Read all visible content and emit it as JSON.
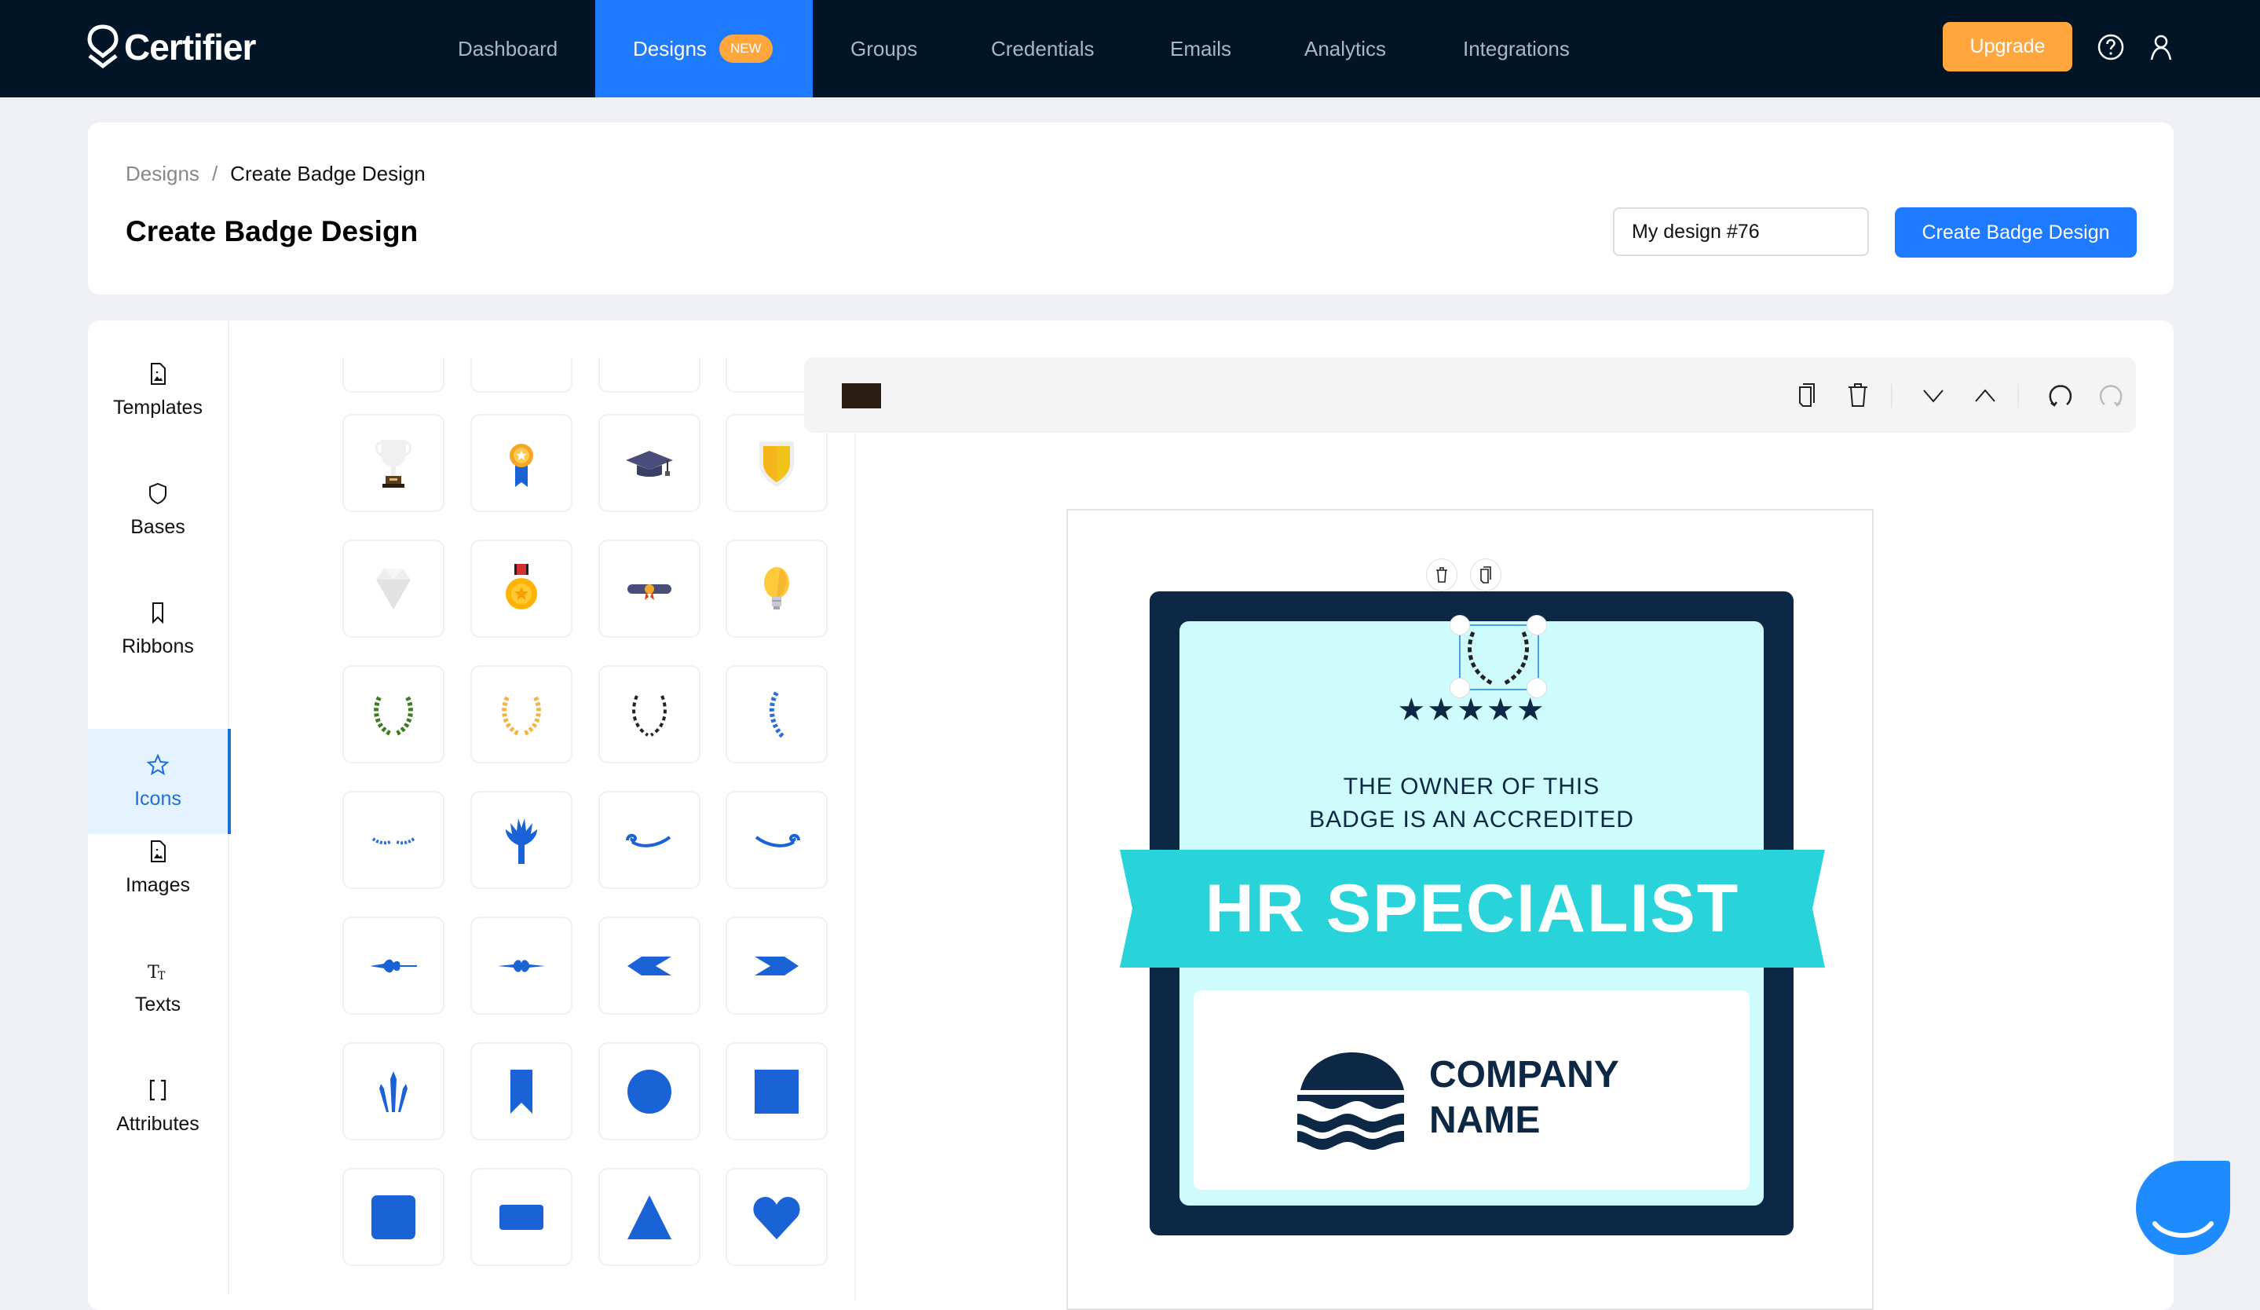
{
  "app": {
    "brand": "Certifier",
    "colors": {
      "nav_bg": "#021526",
      "accent": "#1e7bff",
      "upgrade": "#ffa63d",
      "badge_dark": "#0d2845",
      "badge_light": "#cefbfb",
      "ribbon": "#29d3da"
    }
  },
  "nav": {
    "items": [
      {
        "label": "Dashboard",
        "active": false
      },
      {
        "label": "Designs",
        "active": true,
        "badge": "NEW"
      },
      {
        "label": "Groups",
        "active": false
      },
      {
        "label": "Credentials",
        "active": false
      },
      {
        "label": "Emails",
        "active": false
      },
      {
        "label": "Analytics",
        "active": false
      },
      {
        "label": "Integrations",
        "active": false
      }
    ],
    "upgrade_label": "Upgrade",
    "help_icon": "help-circle-icon",
    "user_icon": "user-icon"
  },
  "header": {
    "breadcrumb": {
      "parent": "Designs",
      "separator": "/",
      "current": "Create Badge Design"
    },
    "title": "Create Badge Design",
    "design_name_value": "My design #76",
    "create_button_label": "Create Badge Design"
  },
  "sidebar": {
    "items": [
      {
        "label": "Templates",
        "icon": "file-image-icon",
        "active": false
      },
      {
        "label": "Bases",
        "icon": "shield-icon",
        "active": false
      },
      {
        "label": "Ribbons",
        "icon": "bookmark-icon",
        "active": false
      },
      {
        "label": "Icons",
        "icon": "star-icon",
        "active": true
      },
      {
        "label": "Images",
        "icon": "file-image-icon",
        "active": false
      },
      {
        "label": "Texts",
        "icon": "text-size-icon",
        "active": false
      },
      {
        "label": "Attributes",
        "icon": "brackets-icon",
        "active": false
      }
    ]
  },
  "icon_grid": {
    "rows": [
      [
        "trophy-icon",
        "medal-ribbon-icon",
        "graduation-cap-icon",
        "shield-gold-icon"
      ],
      [
        "diamond-icon",
        "medal-star-icon",
        "diploma-scroll-icon",
        "lightbulb-icon"
      ],
      [
        "laurel-green-icon",
        "laurel-gold-icon",
        "laurel-black-icon",
        "laurel-half-blue-icon"
      ],
      [
        "laurel-small-blue-icon",
        "fan-ornament-icon",
        "swirl-left-icon",
        "swirl-right-icon"
      ],
      [
        "fleur-divider-icon",
        "fleur-divider-alt-icon",
        "chevron-left-shape-icon",
        "chevron-right-shape-icon"
      ],
      [
        "crown-spikes-icon",
        "bookmark-shape-icon",
        "circle-shape-icon",
        "square-shape-icon"
      ],
      [
        "rounded-square-shape-icon",
        "rounded-rect-shape-icon",
        "triangle-shape-icon",
        "heart-shape-icon"
      ]
    ]
  },
  "toolbar": {
    "color_swatch": "#2b1c14",
    "buttons": [
      "duplicate",
      "delete",
      "move-down",
      "move-up",
      "undo",
      "redo"
    ]
  },
  "badge": {
    "stars": "★★★★★",
    "owner_line1": "THE OWNER OF THIS",
    "owner_line2": "BADGE IS AN ACCREDITED",
    "title": "HR SPECIALIST",
    "company_line1": "COMPANY",
    "company_line2": "NAME"
  }
}
